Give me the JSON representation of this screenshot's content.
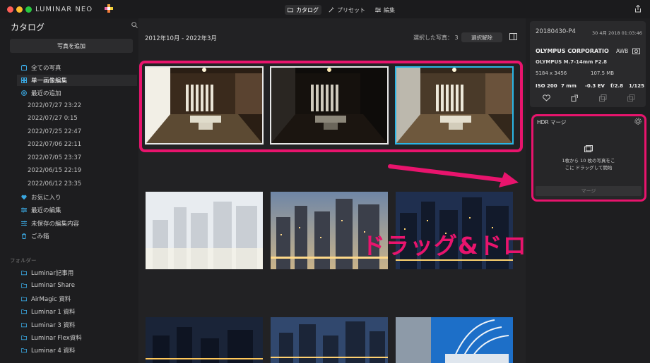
{
  "app": {
    "logo_text": "LUMINAR NEO"
  },
  "toolbar": {
    "tabs": [
      {
        "label": "カタログ",
        "icon": "folder-icon",
        "active": true
      },
      {
        "label": "プリセット",
        "icon": "magic-wand-icon",
        "active": false
      },
      {
        "label": "編集",
        "icon": "sliders-icon",
        "active": false
      }
    ]
  },
  "sidebar": {
    "title": "カタログ",
    "add_button": "写真を追加",
    "items": [
      {
        "label": "全ての写真",
        "icon": "photos-icon"
      },
      {
        "label": "単一画像編集",
        "icon": "grid-icon",
        "selected": true
      },
      {
        "label": "最近の追加",
        "icon": "plus-circle-icon"
      }
    ],
    "recent_dates": [
      "2022/07/27 23:22",
      "2022/07/27 0:15",
      "2022/07/25 22:47",
      "2022/07/06 22:11",
      "2022/07/05 23:37",
      "2022/06/15 22:19",
      "2022/06/12 23:35"
    ],
    "items2": [
      {
        "label": "お気に入り",
        "icon": "heart-icon"
      },
      {
        "label": "最近の編集",
        "icon": "sliders-icon"
      },
      {
        "label": "未保存の編集内容",
        "icon": "sliders-icon"
      },
      {
        "label": "ごみ箱",
        "icon": "trash-icon"
      }
    ],
    "folders_title": "フォルダー",
    "folders": [
      "Luminar記事用",
      "Luminar Share",
      "AirMagic 資料",
      "Luminar 1 資料",
      "Luminar 3 資料",
      "Luminar Flex資料",
      "Luminar 4 資料"
    ]
  },
  "main": {
    "date_range": "2012年10月 - 2022年3月",
    "selected_label": "選択した写真：",
    "selected_count": "3",
    "deselect": "選択解除"
  },
  "info": {
    "filename": "20180430-P4",
    "date": "30 4月 2018 01:03:46",
    "camera": "OLYMPUS CORPORATIO",
    "wb": "AWB",
    "lens": "OLYMPUS M.7-14mm F2.8",
    "dimensions": "5184 x 3456",
    "filesize": "107.5 MB",
    "iso": "ISO 200",
    "focal": "7 mm",
    "ev": "-0.3 EV",
    "aperture": "f/2.8",
    "shutter": "1/125"
  },
  "hdr": {
    "title": "HDR マージ",
    "drop_line1": "1枚から 10 枚の写真をこ",
    "drop_line2": "こに ドラッグして開始",
    "merge_button": "マージ"
  },
  "annotation": {
    "text": "ドラッグ&ドロップ",
    "color": "#e8146d"
  }
}
